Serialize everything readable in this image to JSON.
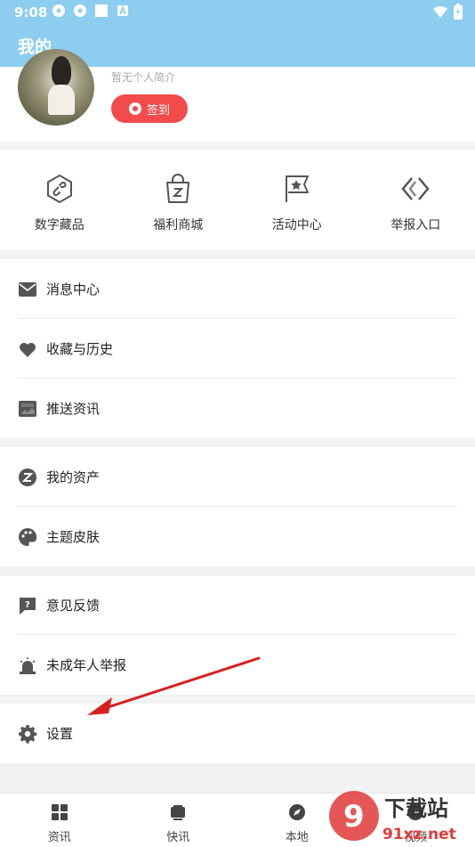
{
  "status_bar": {
    "time": "9:08"
  },
  "header": {
    "title": "我的"
  },
  "profile": {
    "bio": "暂无个人简介",
    "signin_label": "签到"
  },
  "shortcuts": [
    {
      "label": "数字藏品",
      "icon": "hexagon-link-icon"
    },
    {
      "label": "福利商城",
      "icon": "shopping-bag-icon"
    },
    {
      "label": "活动中心",
      "icon": "star-flag-icon"
    },
    {
      "label": "举报入口",
      "icon": "diamond-report-icon"
    }
  ],
  "menu_groups": [
    [
      {
        "label": "消息中心",
        "icon": "envelope-icon"
      },
      {
        "label": "收藏与历史",
        "icon": "heart-icon"
      },
      {
        "label": "推送资讯",
        "icon": "push-icon"
      }
    ],
    [
      {
        "label": "我的资产",
        "icon": "asset-coin-icon"
      },
      {
        "label": "主题皮肤",
        "icon": "palette-icon"
      }
    ],
    [
      {
        "label": "意见反馈",
        "icon": "feedback-icon"
      },
      {
        "label": "未成年人举报",
        "icon": "alarm-icon"
      }
    ],
    [
      {
        "label": "设置",
        "icon": "gear-icon"
      }
    ]
  ],
  "tab_bar": [
    {
      "label": "资讯",
      "icon": "grid-icon"
    },
    {
      "label": "快讯",
      "icon": "tv-icon"
    },
    {
      "label": "本地",
      "icon": "compass-icon"
    },
    {
      "label": "视频",
      "icon": "play-icon"
    }
  ],
  "watermark": {
    "brand_cn": "下载站",
    "domain": "91xz.net",
    "logo_text": "9"
  },
  "colors": {
    "header_bg": "#8ccdf0",
    "accent_red": "#f24b4b",
    "arrow": "#d92020"
  }
}
